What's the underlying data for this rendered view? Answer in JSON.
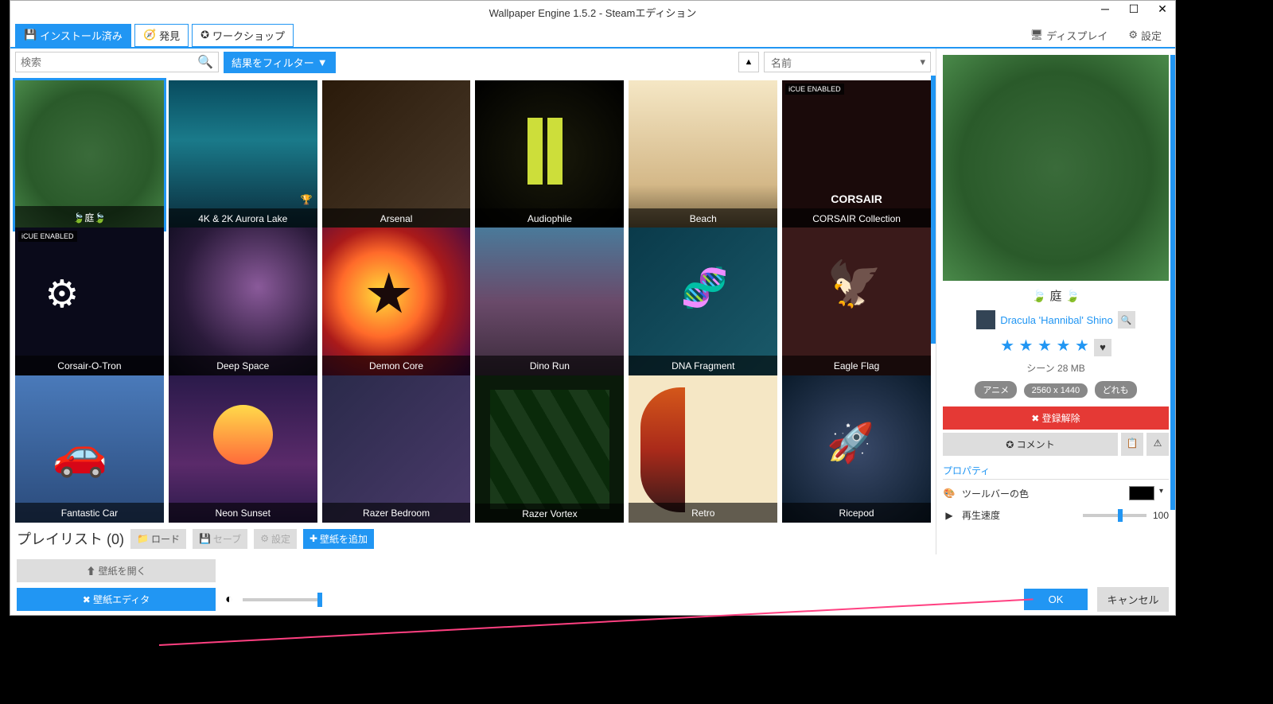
{
  "title": "Wallpaper Engine 1.5.2 - Steamエディション",
  "tabs": {
    "installed": "インストール済み",
    "discover": "発見",
    "workshop": "ワークショップ"
  },
  "top_right": {
    "display": "ディスプレイ",
    "settings": "設定"
  },
  "search": {
    "placeholder": "検索",
    "filter": "結果をフィルター",
    "sort": "名前"
  },
  "tiles": [
    {
      "label": "🍃庭🍃"
    },
    {
      "label": "4K & 2K Aurora Lake"
    },
    {
      "label": "Arsenal"
    },
    {
      "label": "Audiophile"
    },
    {
      "label": "Beach"
    },
    {
      "label": "CORSAIR Collection"
    },
    {
      "label": "Corsair-O-Tron"
    },
    {
      "label": "Deep Space"
    },
    {
      "label": "Demon Core"
    },
    {
      "label": "Dino Run"
    },
    {
      "label": "DNA Fragment"
    },
    {
      "label": "Eagle Flag"
    },
    {
      "label": "Fantastic Car"
    },
    {
      "label": "Neon Sunset"
    },
    {
      "label": "Razer Bedroom"
    },
    {
      "label": "Razer Vortex"
    },
    {
      "label": "Retro"
    },
    {
      "label": "Ricepod"
    }
  ],
  "cue_badge": "iCUE ENABLED",
  "playlist": {
    "label": "プレイリスト (0)",
    "load": "ロード",
    "save": "セーブ",
    "settings": "設定",
    "add": "壁紙を追加"
  },
  "bottom": {
    "open": "⬆ 壁紙を開く",
    "editor": "✖ 壁紙エディタ",
    "ok": "OK",
    "cancel": "キャンセル"
  },
  "preview": {
    "title": "🍃 庭 🍃",
    "author": "Dracula 'Hannibal' Shino",
    "stars": "★ ★ ★ ★ ★",
    "meta": "シーン 28 MB",
    "tags": [
      "アニメ",
      "2560 x 1440",
      "どれも"
    ],
    "unsubscribe": "✖ 登録解除",
    "comment": "✪ コメント",
    "section": "プロパティ",
    "prop_color": "ツールバーの色",
    "prop_speed": "再生速度",
    "speed_val": "100"
  }
}
